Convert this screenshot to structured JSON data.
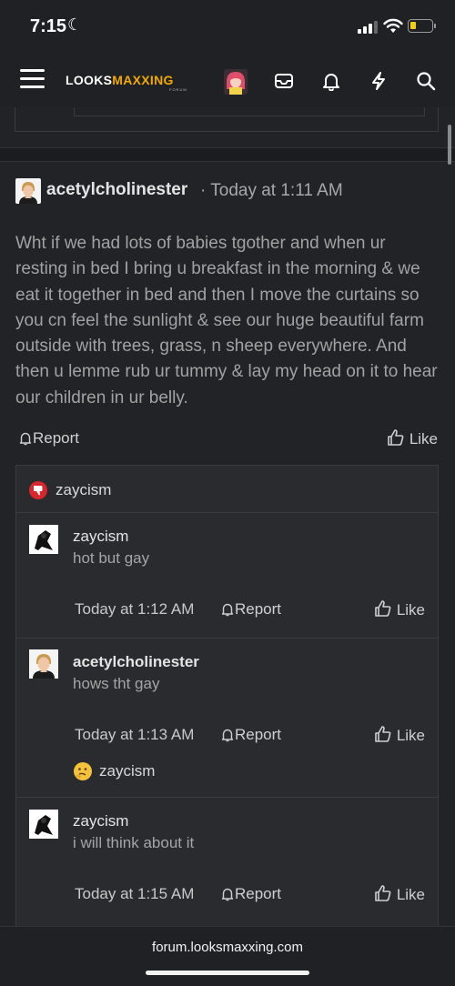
{
  "status_bar": {
    "time": "7:15",
    "battery_level": 0.2
  },
  "navbar": {
    "logo_part1": "LOOKS",
    "logo_part2": "MAXXING",
    "logo_sub": "FORUM",
    "brand_color": "#f2a900"
  },
  "post": {
    "author": "acetylcholinester",
    "date": "· Today at 1:11 AM",
    "body": "Wht if we had lots of babies tgother and when ur resting in bed I bring u breakfast in the morning & we eat it together in bed and then I move the curtains so you cn feel the sunlight & see our huge beautiful farm outside with trees, grass, n sheep everywhere. And then u lemme rub ur tummy & lay my head on it to hear our children in ur belly.",
    "report_label": "Report",
    "like_label": "Like",
    "reaction": {
      "icon": "dislike-icon",
      "color": "#d7262e",
      "user": "zaycism"
    }
  },
  "comments": [
    {
      "author": "zaycism",
      "text": "hot but gay",
      "time": "Today at 1:12 AM",
      "report_label": "Report",
      "like_label": "Like"
    },
    {
      "author": "acetylcholinester",
      "text": "hows tht gay",
      "time": "Today at 1:13 AM",
      "report_label": "Report",
      "like_label": "Like",
      "reaction": {
        "icon": "thinking-face-icon",
        "user": "zaycism"
      }
    },
    {
      "author": "zaycism",
      "text": "i will think about it",
      "time": "Today at 1:15 AM",
      "report_label": "Report",
      "like_label": "Like"
    }
  ],
  "browser": {
    "url": "forum.looksmaxxing.com"
  }
}
